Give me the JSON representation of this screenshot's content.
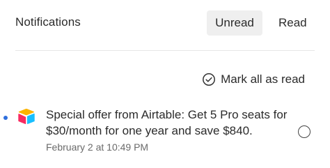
{
  "header": {
    "title": "Notifications",
    "tabs": [
      {
        "label": "Unread",
        "active": true
      },
      {
        "label": "Read",
        "active": false
      }
    ]
  },
  "actions": {
    "mark_all_label": "Mark all as read",
    "mark_all_icon": "check-circle-icon"
  },
  "notifications": [
    {
      "app_icon": "airtable-logo",
      "unread": true,
      "text": "Special offer from Airtable: Get 5 Pro seats for $30/month for one year and save $840.",
      "time": "February 2 at 10:49 PM",
      "mark_read_icon": "empty-circle-icon"
    }
  ],
  "colors": {
    "unread_dot": "#2f6fdd",
    "active_tab_bg": "#efefef",
    "logo_yellow": "#fcb400",
    "logo_blue": "#18bfff",
    "logo_red": "#f82b60"
  }
}
